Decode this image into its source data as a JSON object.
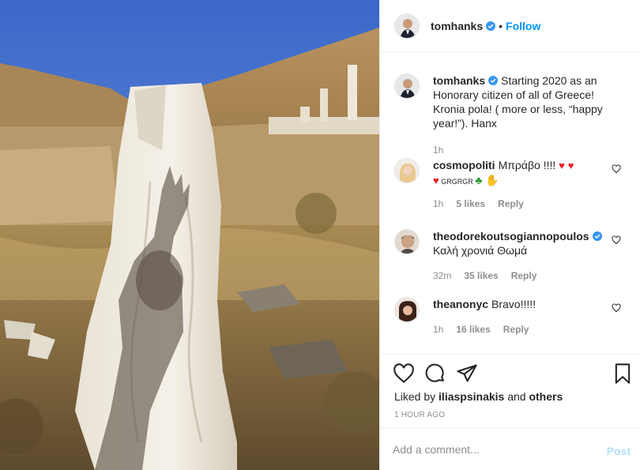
{
  "colors": {
    "follow": "#0095f6",
    "post_disabled": "#b2dffc",
    "secondary_text": "#8e8e8e",
    "verified": "#3897f0"
  },
  "header": {
    "username": "tomhanks",
    "separator": "•",
    "follow_label": "Follow"
  },
  "caption": {
    "username": "tomhanks",
    "text": "Starting 2020 as an Honorary citizen of all of Greece! Kronia pola! ( more or less, “happy year!”). Hanx",
    "time": "1h"
  },
  "comments": [
    {
      "username": "cosmopoliti",
      "text_before": "Μπράβο !!!! ",
      "text_after": " GRGRGR ",
      "time": "1h",
      "likes": "5 likes",
      "reply": "Reply"
    },
    {
      "username": "theodorekoutsogiannopoulos",
      "verified": true,
      "text": "Καλή χρονιά Θωμά",
      "time": "32m",
      "likes": "35 likes",
      "reply": "Reply"
    },
    {
      "username": "theanonyc",
      "text": "Bravo!!!!!",
      "time": "1h",
      "likes": "16 likes",
      "reply": "Reply"
    }
  ],
  "actions": {
    "icons": [
      "heart-icon",
      "comment-icon",
      "share-icon",
      "bookmark-icon"
    ],
    "liked_prefix": "Liked by",
    "liked_user": "iliaspsinakis",
    "liked_joiner": "and",
    "liked_others": "others",
    "timestamp": "1 HOUR AGO"
  },
  "add_comment": {
    "placeholder": "Add a comment...",
    "post_label": "Post"
  }
}
